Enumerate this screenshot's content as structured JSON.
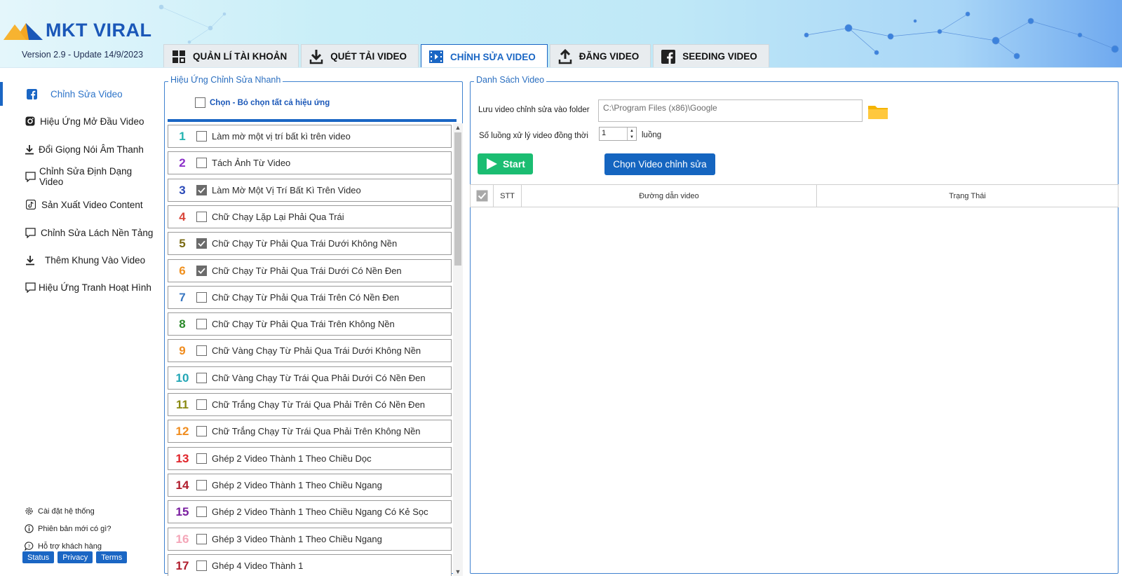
{
  "app": {
    "logo_text": "MKT VIRAL",
    "version": "Version  2.9 - Update 14/9/2023",
    "accent": "#1a66c4"
  },
  "tabs": [
    {
      "label": "QUẢN LÍ TÀI KHOẢN",
      "icon": "accounts-grid-icon"
    },
    {
      "label": "QUÉT TẢI VIDEO",
      "icon": "download-icon"
    },
    {
      "label": "CHỈNH SỬA VIDEO",
      "icon": "video-edit-icon",
      "active": true
    },
    {
      "label": "ĐĂNG VIDEO",
      "icon": "upload-icon"
    },
    {
      "label": "SEEDING VIDEO",
      "icon": "facebook-icon"
    }
  ],
  "sidebar": {
    "items": [
      {
        "label": "Chỉnh Sửa Video",
        "icon": "facebook-icon",
        "active": true
      },
      {
        "label": "Hiệu Ứng Mở Đầu Video",
        "icon": "instagram-icon"
      },
      {
        "label": "Đổi Giọng Nói Âm Thanh",
        "icon": "download-icon"
      },
      {
        "label": "Chỉnh Sửa Định Dạng Video",
        "icon": "chat-bubble-icon"
      },
      {
        "label": "Sản Xuất Video Content",
        "icon": "tiktok-icon"
      },
      {
        "label": "Chỉnh Sửa Lách Nền Tảng",
        "icon": "chat-bubble-icon"
      },
      {
        "label": "Thêm Khung Vào Video",
        "icon": "download-icon"
      },
      {
        "label": "Hiệu Ứng Tranh Hoạt Hình",
        "icon": "chat-bubble-icon"
      }
    ],
    "footer": [
      {
        "label": "Cài đặt hệ thống",
        "icon": "gear-icon"
      },
      {
        "label": "Phiên bản mới có gì?",
        "icon": "info-icon"
      },
      {
        "label": "Hỗ trợ khách hàng",
        "icon": "chat-help-icon"
      }
    ],
    "badges": [
      "Status",
      "Privacy",
      "Terms"
    ]
  },
  "effects": {
    "title": "Hiệu Ứng Chỉnh Sửa Nhanh",
    "select_all_label": "Chọn - Bỏ chọn tất cả hiệu ứng",
    "items": [
      {
        "num": "1",
        "label": "Làm mờ một vị trí bất kì trên video",
        "checked": false,
        "color": "#22b3b0"
      },
      {
        "num": "2",
        "label": "Tách Ảnh Từ Video",
        "checked": false,
        "color": "#8b2fc9"
      },
      {
        "num": "3",
        "label": "Làm Mờ Một Vị Trí Bất Kì Trên Video",
        "checked": true,
        "color": "#2a49b8"
      },
      {
        "num": "4",
        "label": "Chữ Chạy Lặp Lại Phải Qua Trái",
        "checked": false,
        "color": "#d9463a"
      },
      {
        "num": "5",
        "label": "Chữ Chạy Từ Phải Qua Trái Dưới Không Nền",
        "checked": true,
        "color": "#7a6a12"
      },
      {
        "num": "6",
        "label": "Chữ Chạy Từ Phải Qua Trái Dưới Có Nền Đen",
        "checked": true,
        "color": "#f0901e"
      },
      {
        "num": "7",
        "label": "Chữ Chạy Từ Phải Qua Trái Trên Có Nền Đen",
        "checked": false,
        "color": "#3a78c2"
      },
      {
        "num": "8",
        "label": "Chữ Chạy Từ Phải Qua Trái Trên Không Nền",
        "checked": false,
        "color": "#2a8a2a"
      },
      {
        "num": "9",
        "label": "Chữ Vàng Chạy Từ Phải Qua Trái Dưới Không Nền",
        "checked": false,
        "color": "#f08c1e"
      },
      {
        "num": "10",
        "label": "Chữ Vàng Chạy Từ  Trái Qua Phải Dưới Có Nền Đen",
        "checked": false,
        "color": "#22a6b5"
      },
      {
        "num": "11",
        "label": "Chữ Trắng Chạy Từ Trái Qua Phải Trên Có Nền Đen",
        "checked": false,
        "color": "#8a8a12"
      },
      {
        "num": "12",
        "label": "Chữ Trắng Chạy Từ Trái Qua Phải Trên Không Nền",
        "checked": false,
        "color": "#f08c1e"
      },
      {
        "num": "13",
        "label": "Ghép 2 Video Thành 1 Theo Chiều Dọc",
        "checked": false,
        "color": "#e0242a"
      },
      {
        "num": "14",
        "label": "Ghép 2 Video Thành 1 Theo Chiều Ngang",
        "checked": false,
        "color": "#b01c2c"
      },
      {
        "num": "15",
        "label": "Ghép 2 Video Thành 1 Theo Chiều Ngang Có Kẻ Sọc",
        "checked": false,
        "color": "#7a1ea0"
      },
      {
        "num": "16",
        "label": "Ghép 3 Video Thành 1 Theo Chiều Ngang",
        "checked": false,
        "color": "#f4a6b8"
      },
      {
        "num": "17",
        "label": "Ghép 4 Video Thành 1",
        "checked": false,
        "color": "#b01c2c"
      }
    ]
  },
  "video_list": {
    "title": "Danh Sách Video",
    "folder_label": "Lưu video chỉnh sửa vào folder",
    "folder_value": "C:\\Program Files (x86)\\Google",
    "threads_label": "Số luồng xử lý video đồng thời",
    "threads_value": "1",
    "threads_unit": "luồng",
    "start_label": "Start",
    "choose_label": "Chọn Video chỉnh sửa",
    "columns": [
      "STT",
      "Đường dẫn video",
      "Trạng Thái"
    ]
  }
}
